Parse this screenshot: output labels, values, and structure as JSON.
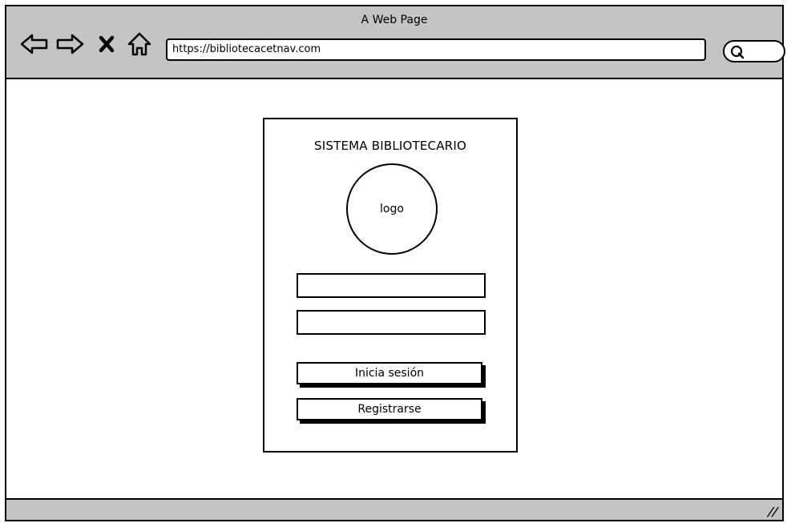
{
  "window": {
    "title": "A Web Page",
    "url": "https://bibliotecacetnav.com"
  },
  "toolbar": {
    "back_icon": "back-arrow-icon",
    "forward_icon": "forward-arrow-icon",
    "stop_icon": "close-icon",
    "home_icon": "home-icon",
    "search_icon": "search-icon"
  },
  "login": {
    "title": "SISTEMA BIBLIOTECARIO",
    "logo_text": "logo",
    "username_value": "",
    "password_value": "",
    "login_button": "Inicia sesión",
    "register_button": "Registrarse"
  },
  "colors": {
    "chrome": "#c4c4c4",
    "stroke": "#000000",
    "background": "#ffffff"
  }
}
